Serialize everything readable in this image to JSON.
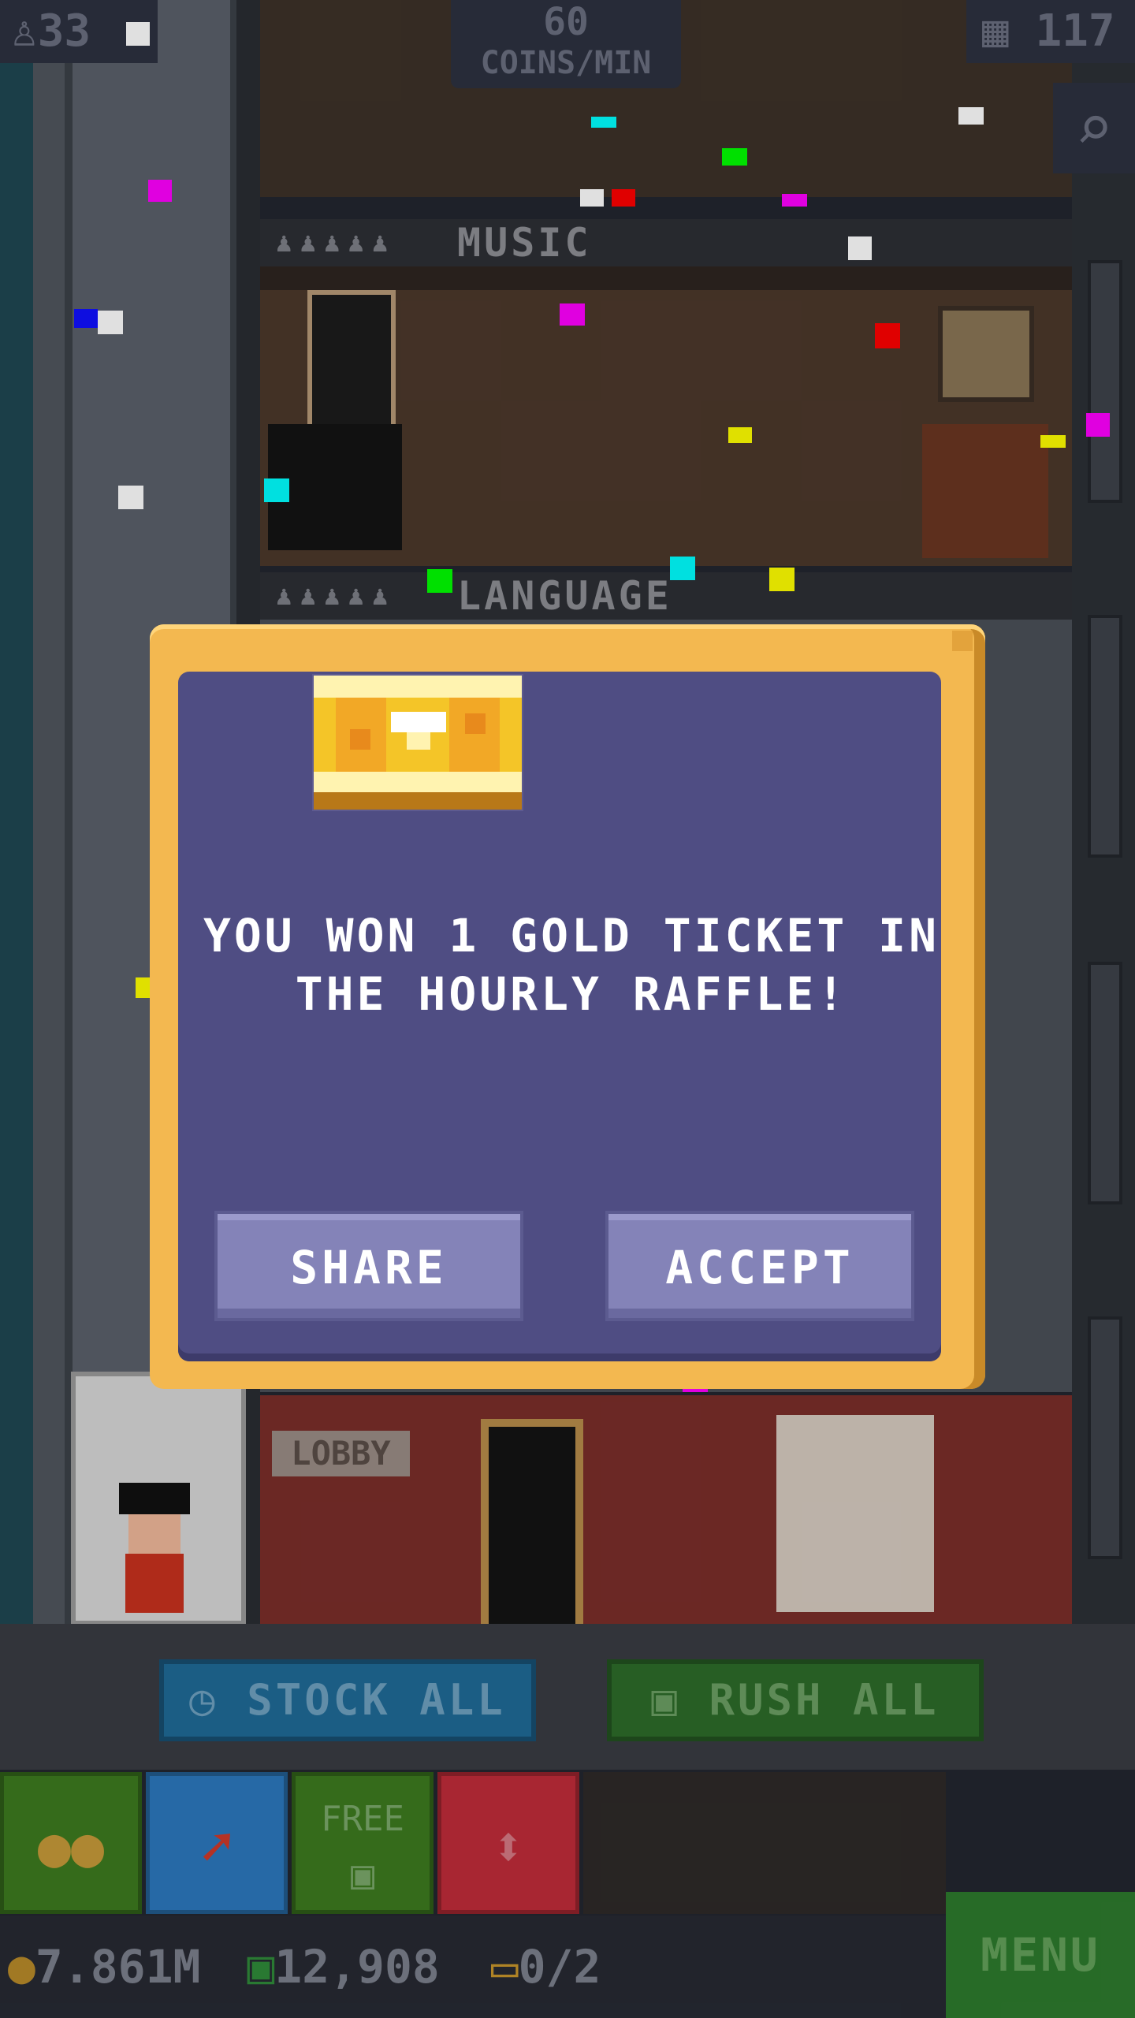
{
  "hud": {
    "population": "33",
    "coins_rate_value": "60",
    "coins_rate_unit": "COINS/MIN",
    "floors": "117"
  },
  "floors": [
    {
      "name": "MUSIC"
    },
    {
      "name": "LANGUAGE"
    }
  ],
  "lobby": {
    "sign": "LOBBY"
  },
  "dialog": {
    "icon": "gold-ticket-icon",
    "message": "YOU WON 1 GOLD TICKET IN THE HOURLY RAFFLE!",
    "share_label": "SHARE",
    "accept_label": "ACCEPT"
  },
  "actions": {
    "stock_all": "STOCK ALL",
    "rush_all": "RUSH ALL"
  },
  "toolbar": {
    "free_label": "FREE"
  },
  "status": {
    "coins": "7.861M",
    "bux": "12,908",
    "tickets": "0/2",
    "menu_label": "MENU"
  },
  "colors": {
    "dialog_frame": "#f3b850",
    "dialog_body": "#4f4d83",
    "dialog_button": "#8483b8",
    "stock_button": "#1f6a97",
    "rush_button": "#2d6b2a",
    "menu_button": "#2d7a2d"
  }
}
